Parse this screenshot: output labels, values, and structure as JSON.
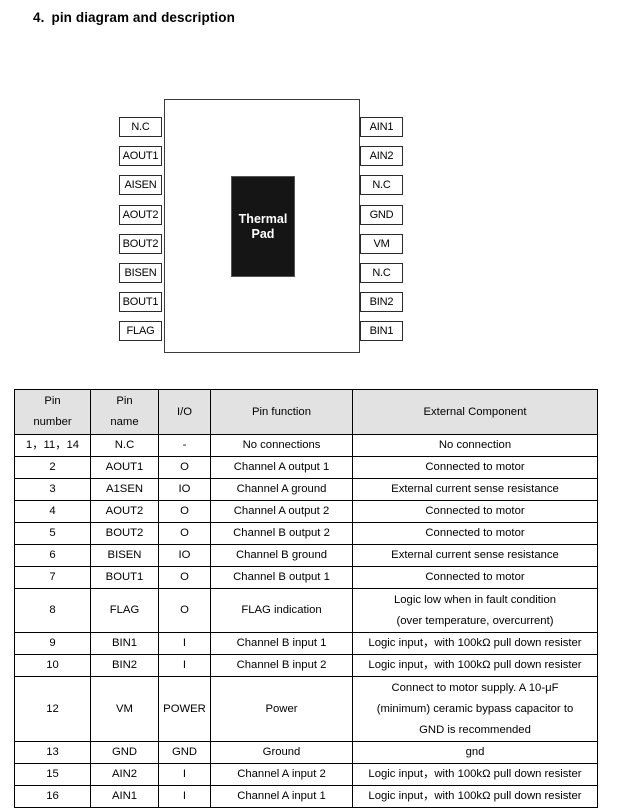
{
  "heading": {
    "number": "4.",
    "text": "pin diagram and description"
  },
  "diagram": {
    "thermal_pad_label_line1": "Thermal",
    "thermal_pad_label_line2": "Pad",
    "left_pins": [
      {
        "label": "N.C"
      },
      {
        "label": "AOUT1"
      },
      {
        "label": "AISEN"
      },
      {
        "label": "AOUT2"
      },
      {
        "label": "BOUT2"
      },
      {
        "label": "BISEN"
      },
      {
        "label": "BOUT1"
      },
      {
        "label": "FLAG"
      }
    ],
    "right_pins": [
      {
        "label": "AIN1"
      },
      {
        "label": "AIN2"
      },
      {
        "label": "N.C"
      },
      {
        "label": "GND"
      },
      {
        "label": "VM"
      },
      {
        "label": "N.C"
      },
      {
        "label": "BIN2"
      },
      {
        "label": "BIN1"
      }
    ]
  },
  "table": {
    "headers": {
      "pin_number_line1": "Pin",
      "pin_number_line2": "number",
      "pin_name_line1": "Pin",
      "pin_name_line2": "name",
      "io": "I/O",
      "pin_function": "Pin function",
      "external_component": "External Component"
    },
    "rows": [
      {
        "number": "1，11，14",
        "name": "N.C",
        "io": "-",
        "function": "No connections",
        "external": [
          "No connection"
        ]
      },
      {
        "number": "2",
        "name": "AOUT1",
        "io": "O",
        "function": "Channel A output 1",
        "external": [
          "Connected to motor"
        ]
      },
      {
        "number": "3",
        "name": "A1SEN",
        "io": "IO",
        "function": "Channel A ground",
        "external": [
          "External current sense resistance"
        ]
      },
      {
        "number": "4",
        "name": "AOUT2",
        "io": "O",
        "function": "Channel A output 2",
        "external": [
          "Connected to motor"
        ]
      },
      {
        "number": "5",
        "name": "BOUT2",
        "io": "O",
        "function": "Channel B output 2",
        "external": [
          "Connected to motor"
        ]
      },
      {
        "number": "6",
        "name": "BISEN",
        "io": "IO",
        "function": "Channel B ground",
        "external": [
          "External current sense resistance"
        ]
      },
      {
        "number": "7",
        "name": "BOUT1",
        "io": "O",
        "function": "Channel B output 1",
        "external": [
          "Connected to motor"
        ]
      },
      {
        "number": "8",
        "name": "FLAG",
        "io": "O",
        "function": "FLAG indication",
        "external": [
          "Logic low when in fault condition",
          "(over temperature, overcurrent)"
        ]
      },
      {
        "number": "9",
        "name": "BIN1",
        "io": "I",
        "function": "Channel B input 1",
        "external": [
          "Logic input，with 100kΩ pull down resister"
        ]
      },
      {
        "number": "10",
        "name": "BIN2",
        "io": "I",
        "function": "Channel B input 2",
        "external": [
          "Logic input，with 100kΩ pull down resister"
        ]
      },
      {
        "number": "12",
        "name": "VM",
        "io": "POWER",
        "function": "Power",
        "external": [
          "Connect to motor supply. A 10-μF",
          "(minimum) ceramic bypass capacitor to",
          "GND is recommended"
        ]
      },
      {
        "number": "13",
        "name": "GND",
        "io": "GND",
        "function": "Ground",
        "external": [
          "gnd"
        ]
      },
      {
        "number": "15",
        "name": "AIN2",
        "io": "I",
        "function": "Channel A input 2",
        "external": [
          "Logic input，with 100kΩ pull down resister"
        ]
      },
      {
        "number": "16",
        "name": "AIN1",
        "io": "I",
        "function": "Channel A input 1",
        "external": [
          "Logic input，with 100kΩ pull down resister"
        ]
      }
    ]
  },
  "colors": {
    "header_background": "#e2e2e2",
    "thermal_pad_background": "#151515",
    "border": "#000000"
  }
}
